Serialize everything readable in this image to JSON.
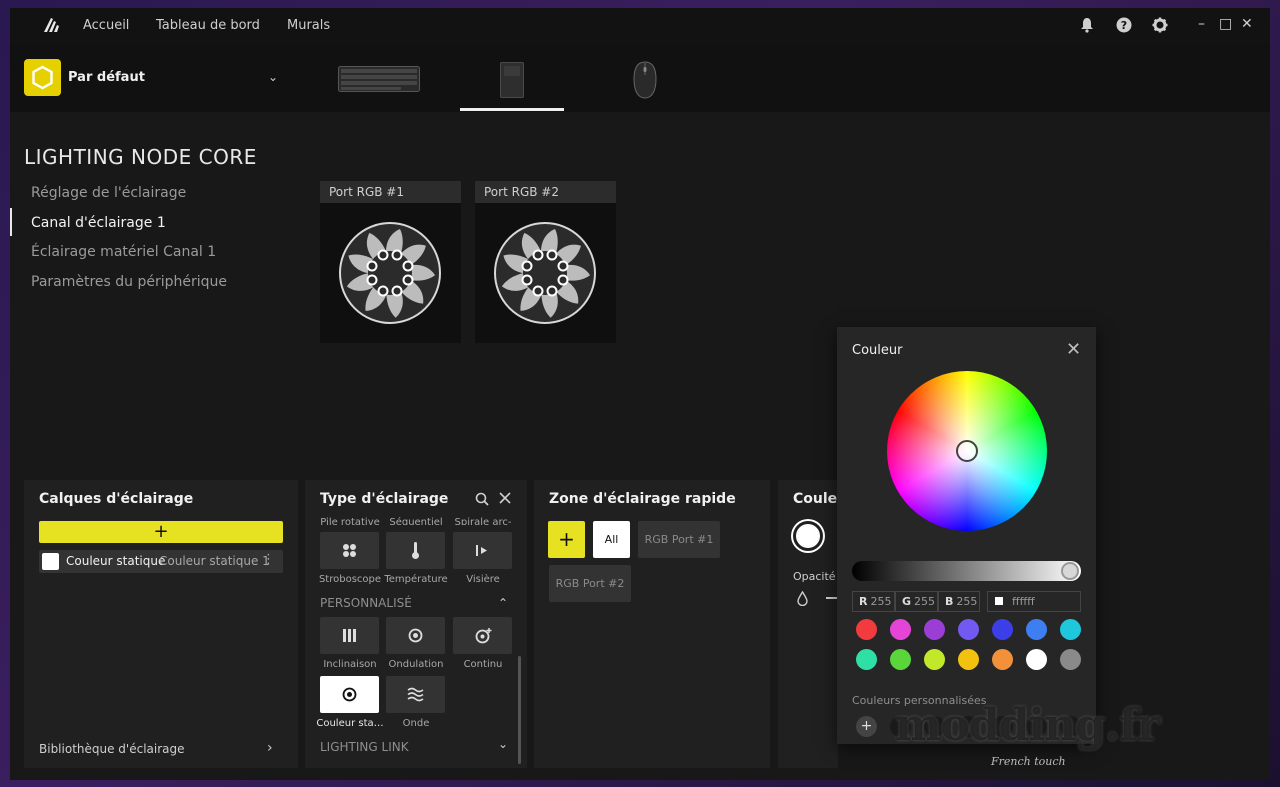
{
  "nav": {
    "items": [
      "Accueil",
      "Tableau de bord",
      "Murals"
    ],
    "icons": [
      "corsair-logo-icon",
      "bell-icon",
      "help-icon",
      "gear-icon"
    ],
    "window": {
      "minimize": "–",
      "maximize": "□",
      "close": "✕"
    }
  },
  "profile": {
    "name": "Par défaut",
    "icon": "hexagon-icon",
    "chevron": "⌄"
  },
  "devices": [
    "keyboard",
    "lighting-node-core",
    "mouse"
  ],
  "page": {
    "title": "LIGHTING NODE CORE",
    "sidebar": [
      {
        "label": "Réglage de l'éclairage",
        "active": false
      },
      {
        "label": "Canal d'éclairage 1",
        "active": true
      },
      {
        "label": "Éclairage matériel Canal 1",
        "active": false
      },
      {
        "label": "Paramètres du périphérique",
        "active": false
      }
    ]
  },
  "ports": [
    {
      "label": "Port RGB #1"
    },
    {
      "label": "Port RGB #2"
    }
  ],
  "layers": {
    "title": "Calques d'éclairage",
    "add": "+",
    "item": {
      "name": "Couleur statique",
      "sub": "Couleur statique 1",
      "menu": "⋮"
    },
    "library": "Bibliothèque d'éclairage",
    "library_chevron": "›"
  },
  "types": {
    "title": "Type d'éclairage",
    "cut_labels": [
      "Pile rotative",
      "Séquentiel",
      "Spirale arc-en-…"
    ],
    "row1_labels": [
      "Stroboscope",
      "Température",
      "Visière"
    ],
    "section_custom": "PERSONNALISÉ",
    "row2_labels": [
      "Inclinaison",
      "Ondulation",
      "Continu"
    ],
    "row3_labels": [
      "Couleur sta…",
      "Onde"
    ],
    "section_link": "LIGHTING LINK",
    "chevron_up": "⌃",
    "chevron_down": "⌄"
  },
  "zones": {
    "title": "Zone d'éclairage rapide",
    "add": "+",
    "all": "All",
    "port1": "RGB Port #1",
    "port2": "RGB Port #2"
  },
  "color_panel": {
    "title": "Couleur",
    "opacity_label": "Opacité"
  },
  "popup": {
    "title": "Couleur",
    "close": "✕",
    "r_label": "R",
    "r": "255",
    "g_label": "G",
    "g": "255",
    "b_label": "B",
    "b": "255",
    "hex": "ffffff",
    "brightness": 1.0,
    "swatches_row1": [
      "#f23a3f",
      "#e545d6",
      "#9b3ed6",
      "#7259f2",
      "#3c3ee8",
      "#3d7ff2",
      "#1fc7dc"
    ],
    "swatches_row2": [
      "#2fe0a6",
      "#5ad63a",
      "#c2e82a",
      "#f2c20e",
      "#f2913a",
      "#ffffff",
      "#8a8a8a"
    ],
    "custom_label": "Couleurs personnalisées",
    "custom_add": "+"
  },
  "watermark": {
    "text": "modding.fr",
    "sub": "French touch"
  }
}
